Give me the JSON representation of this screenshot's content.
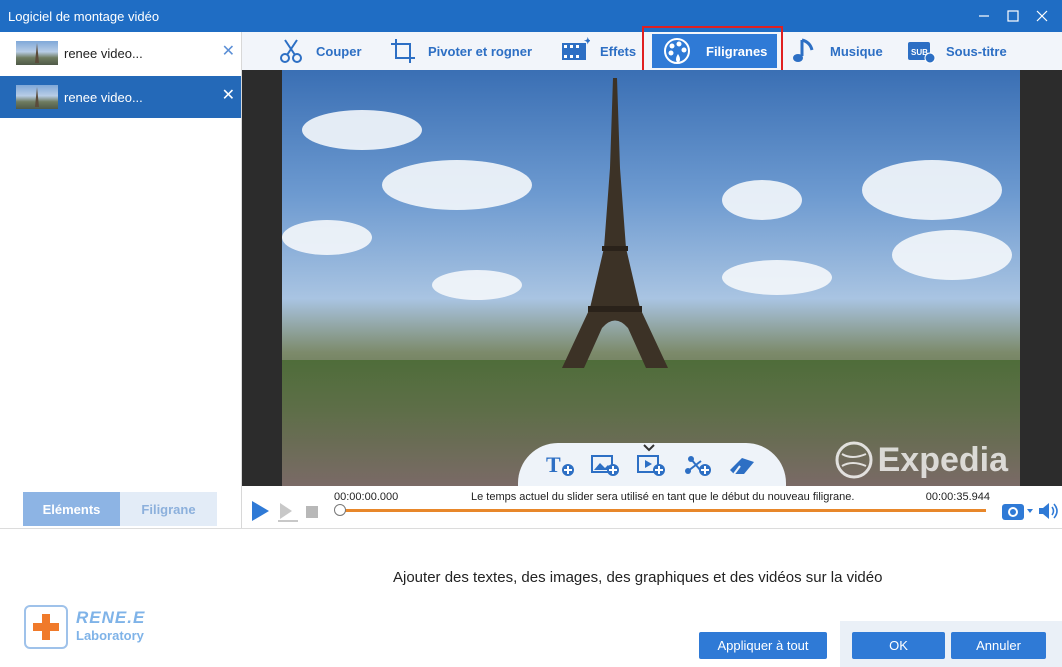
{
  "window": {
    "title": "Logiciel de montage vidéo"
  },
  "clips": [
    {
      "label": "renee video...",
      "selected": false
    },
    {
      "label": "renee video...",
      "selected": true
    }
  ],
  "left_tabs": {
    "elements": "Eléments",
    "watermark": "Filigrane"
  },
  "toolbar": {
    "cut": "Couper",
    "rotate_crop": "Pivoter et rogner",
    "effects": "Effets",
    "watermarks": "Filigranes",
    "music": "Musique",
    "subtitle": "Sous-titre",
    "subtitle_icon_text": "SUB",
    "active": "watermarks"
  },
  "video": {
    "watermark_text": "Expedia"
  },
  "timeline": {
    "current_time": "00:00:00.000",
    "total_time": "00:00:35.944",
    "hint": "Le temps actuel du slider sera utilisé en tant que le début du nouveau filigrane.",
    "position": 0
  },
  "footer": {
    "description": "Ajouter des textes, des images, des graphiques et des vidéos sur la vidéo",
    "apply_all": "Appliquer à tout",
    "ok": "OK",
    "cancel": "Annuler"
  },
  "brand": {
    "name": "RENE.E",
    "sub": "Laboratory"
  },
  "colors": {
    "accent": "#2f7ad6",
    "titlebar": "#1f6dc4",
    "timeline": "#e8872a",
    "highlight": "#e02020"
  }
}
